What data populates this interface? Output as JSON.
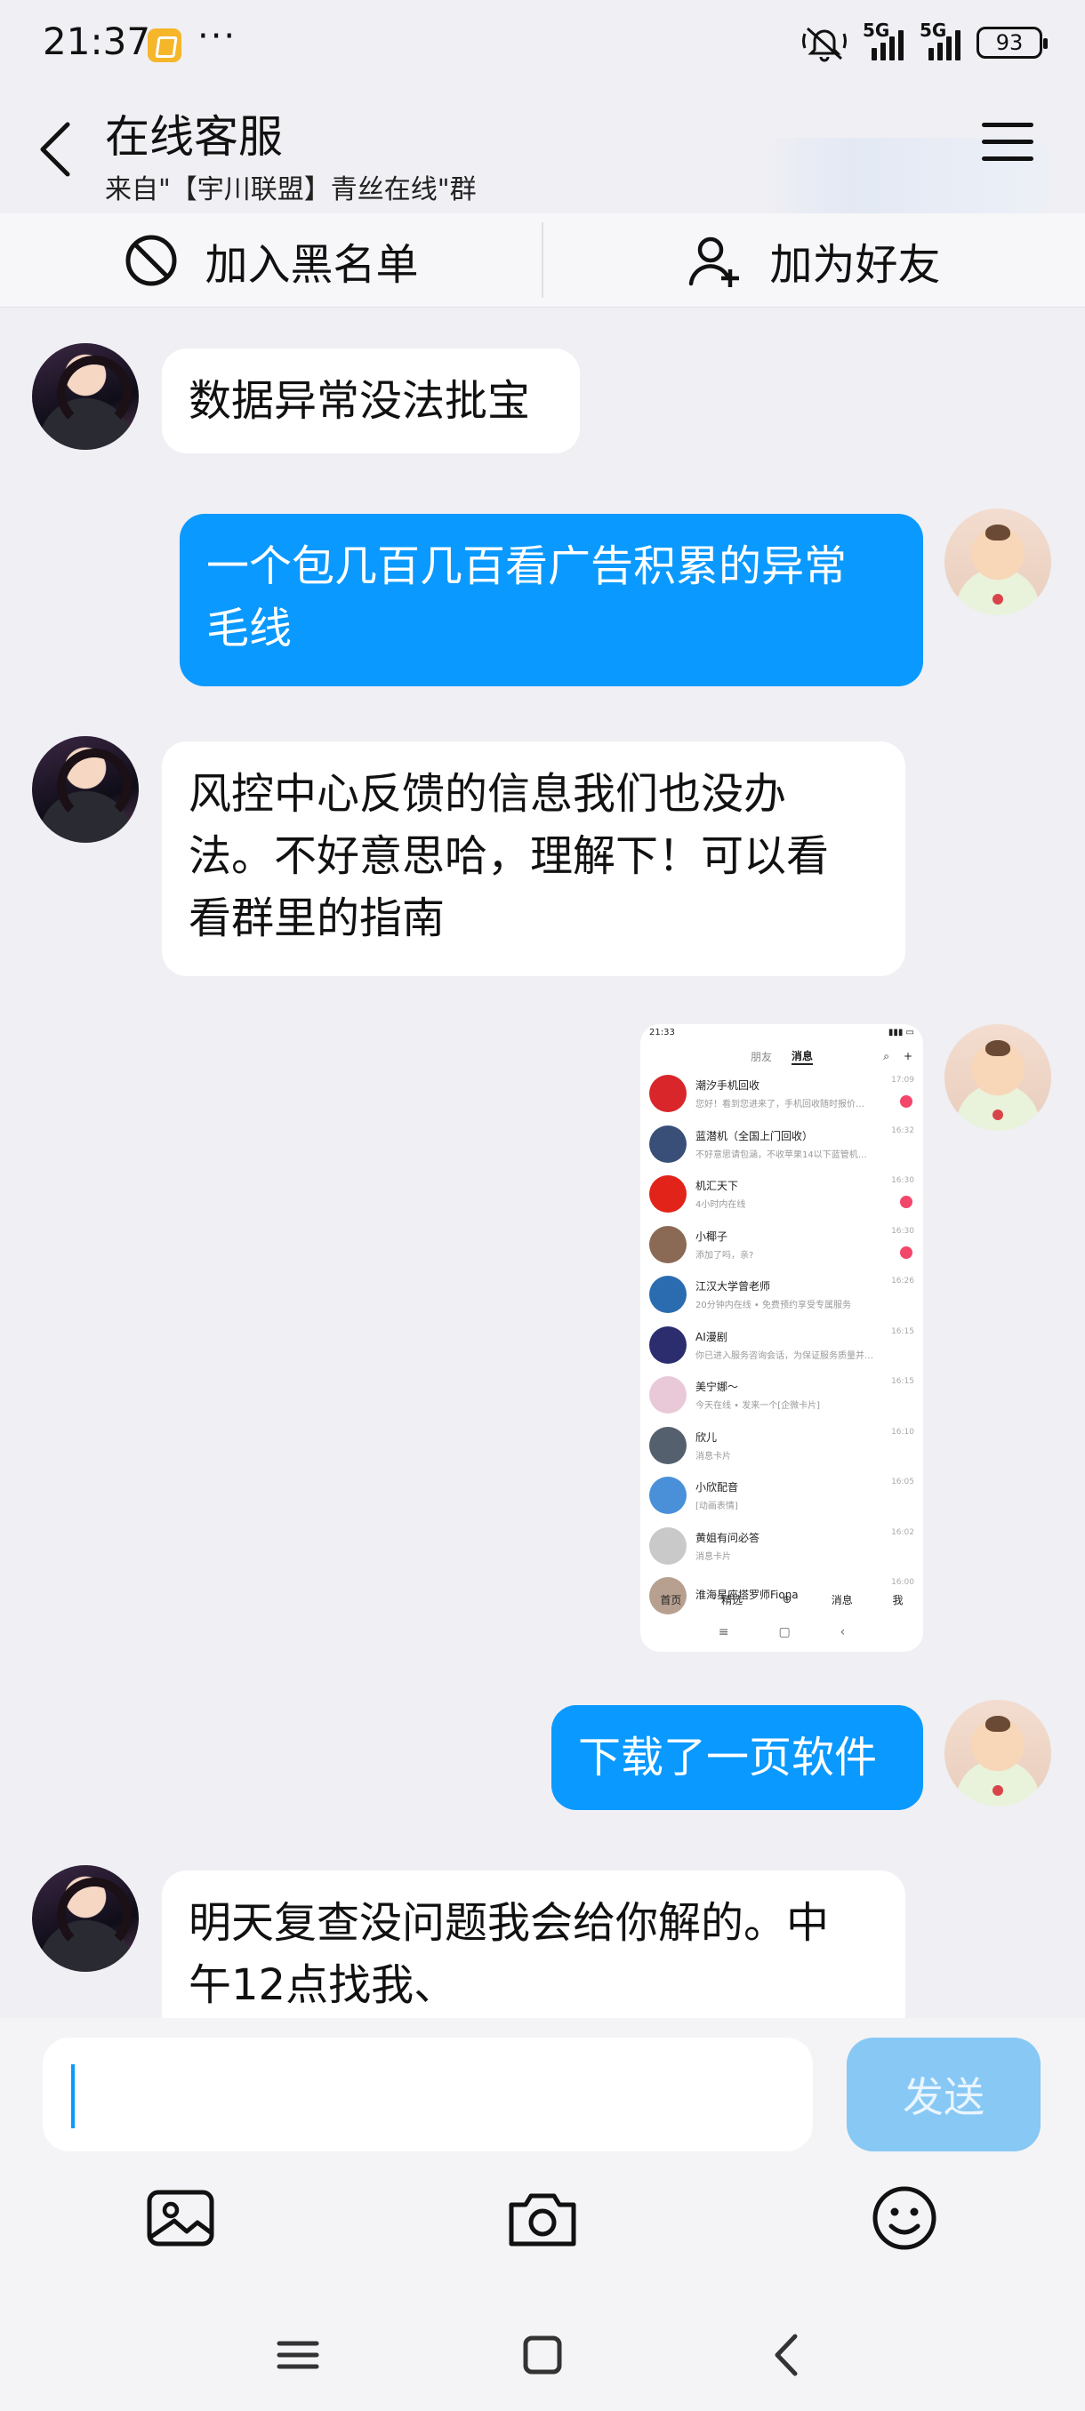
{
  "status_bar": {
    "time": "21:37",
    "more": "···",
    "signal1": "5G",
    "signal2": "5G",
    "battery": "93"
  },
  "header": {
    "title": "在线客服",
    "subtitle": "来自\"【宇川联盟】青丝在线\"群"
  },
  "actions": {
    "blacklist": "加入黑名单",
    "add_friend": "加为好友"
  },
  "messages": [
    {
      "sender": "agent",
      "text": "数据异常没法批宝"
    },
    {
      "sender": "me",
      "text_line1": "一个包几百几百看广告积累的异常",
      "text_line2": "毛线"
    },
    {
      "sender": "agent",
      "text_line1": "风控中心反馈的信息我们也没办",
      "text_line2": "法。不好意思哈，理解下！可以看",
      "text_line3": "看群里的指南"
    },
    {
      "sender": "me",
      "type": "image"
    },
    {
      "sender": "me",
      "text": "下载了一页软件"
    },
    {
      "sender": "agent",
      "text_line1": "明天复查没问题我会给你解的。中",
      "text_line2": "午12点找我、"
    }
  ],
  "embedded_screenshot": {
    "time": "21:33",
    "tabs": [
      "朋友",
      "消息"
    ],
    "rows": [
      {
        "name": "潮汐手机回收",
        "sub": "您好！看到您进来了，手机回收随时报价…",
        "time": "17:09",
        "color": "#d9262b",
        "badge": true
      },
      {
        "name": "蓝潜机（全国上门回收）",
        "sub": "不好意思请包涵，不收苹果14以下蓝管机…",
        "time": "16:32",
        "color": "#3a4f78",
        "badge": false
      },
      {
        "name": "机汇天下",
        "sub": "4小时内在线",
        "time": "16:30",
        "color": "#e2231a",
        "badge": true
      },
      {
        "name": "小椰子",
        "sub": "添加了吗，亲?",
        "time": "16:30",
        "color": "#8a6a55",
        "badge": true
      },
      {
        "name": "江汉大学曾老师",
        "sub": "20分钟内在线 • 免费预约享受专属服务",
        "time": "16:26",
        "color": "#2b6cb0",
        "badge": false
      },
      {
        "name": "AI漫剧",
        "sub": "你已进入服务咨询会话，为保证服务质量并…",
        "time": "16:15",
        "color": "#2b2d6e",
        "badge": false
      },
      {
        "name": "美宁娜～",
        "sub": "今天在线 • 发来一个[企微卡片]",
        "time": "16:15",
        "color": "#e9c9d8",
        "badge": false
      },
      {
        "name": "欣儿",
        "sub": "消息卡片",
        "time": "16:10",
        "color": "#55606e",
        "badge": false
      },
      {
        "name": "小欣配音",
        "sub": "[动画表情]",
        "time": "16:05",
        "color": "#4a90d9",
        "badge": false
      },
      {
        "name": "黄姐有问必答",
        "sub": "消息卡片",
        "time": "16:02",
        "color": "#c9c9c9",
        "badge": false
      },
      {
        "name": "淮海星座塔罗师Fiona",
        "sub": "",
        "time": "16:00",
        "color": "#b8a090",
        "badge": false
      }
    ],
    "nav": [
      "首页",
      "精选",
      "⊕",
      "消息",
      "我"
    ]
  },
  "input": {
    "placeholder": "",
    "send_label": "发送"
  },
  "colors": {
    "accent": "#0a99ff",
    "send_disabled": "#87c8f5",
    "background": "#efeff4"
  },
  "icons": [
    "back-icon",
    "menu-icon",
    "block-icon",
    "add-friend-icon",
    "image-icon",
    "camera-icon",
    "emoji-icon",
    "recents-icon",
    "home-icon",
    "back-nav-icon"
  ]
}
